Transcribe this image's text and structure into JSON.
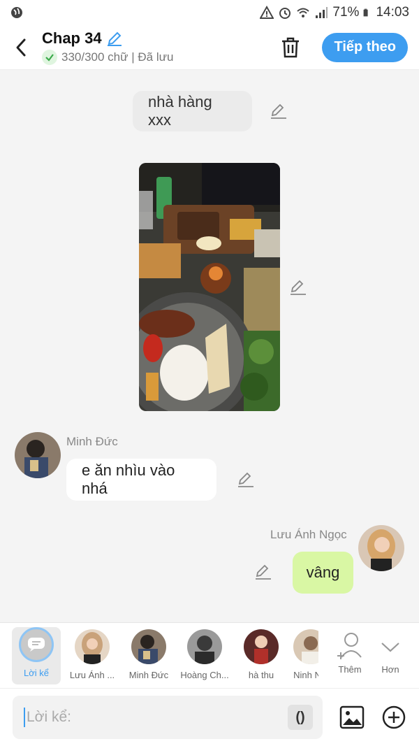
{
  "status_bar": {
    "battery": "71%",
    "time": "14:03"
  },
  "header": {
    "title": "Chap 34",
    "subtitle": "330/300 chữ | Đã lưu",
    "next_label": "Tiếp theo"
  },
  "messages": [
    {
      "type": "narration",
      "text": "nhà hàng xxx"
    },
    {
      "type": "image",
      "description": "food-photo"
    },
    {
      "type": "left",
      "sender": "Minh Đức",
      "text": "e ăn nhìu vào nhá"
    },
    {
      "type": "right",
      "sender": "Lưu Ánh Ngọc",
      "text": "vâng"
    }
  ],
  "characters": [
    {
      "label": "Lời kể",
      "active": true
    },
    {
      "label": "Lưu Ánh ...",
      "color": "#c9a27a"
    },
    {
      "label": "Minh Đức",
      "color": "#6b5a4a"
    },
    {
      "label": "Hoàng Ch...",
      "color": "#5d5d5d"
    },
    {
      "label": "hà thu",
      "color": "#a0403a"
    },
    {
      "label": "Ninh N",
      "color": "#b59a84"
    }
  ],
  "actions": {
    "add_label": "Thêm",
    "more_label": "Hơn"
  },
  "input": {
    "placeholder": "Lời kể:",
    "paren": "()"
  },
  "colors": {
    "accent": "#3d9df0",
    "right_bubble": "#d9f7a4",
    "narration_bubble": "#ebebeb"
  }
}
